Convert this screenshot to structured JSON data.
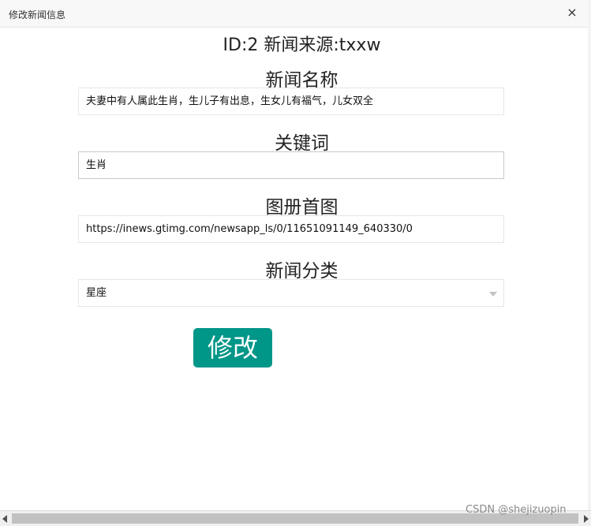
{
  "dialog": {
    "title": "修改新闻信息",
    "close_label": "×"
  },
  "form": {
    "header": "ID:2 新闻来源:txxw",
    "name_label": "新闻名称",
    "name_value": "夫妻中有人属此生肖，生儿子有出息，生女儿有福气，儿女双全",
    "keyword_label": "关键词",
    "keyword_value": "生肖",
    "cover_label": "图册首图",
    "cover_value": "https://inews.gtimg.com/newsapp_ls/0/11651091149_640330/0",
    "category_label": "新闻分类",
    "category_value": "星座",
    "submit_label": "修改"
  },
  "watermark": "CSDN @shejizuopin",
  "colors": {
    "primary_button": "#009688",
    "titlebar_bg": "#f8f8f8"
  },
  "icons": {
    "close": "close-icon",
    "select_caret": "caret-down-icon"
  }
}
